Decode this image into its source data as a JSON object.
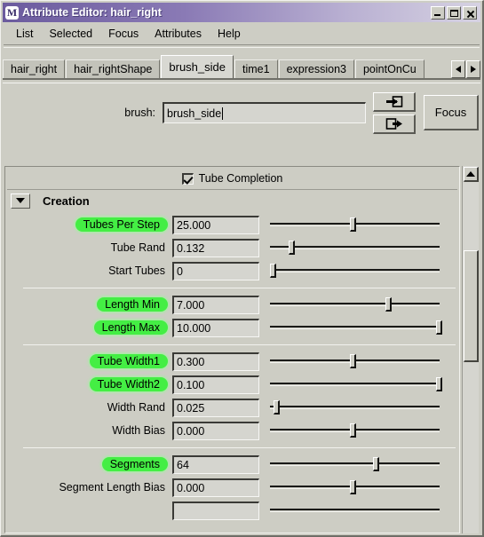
{
  "window": {
    "logo": "maya-m-logo",
    "title": "Attribute Editor: hair_right",
    "buttons": {
      "minimize": "minimize-icon",
      "maximize": "maximize-icon",
      "close": "close-icon"
    }
  },
  "menubar": {
    "items": [
      {
        "label": "List"
      },
      {
        "label": "Selected"
      },
      {
        "label": "Focus"
      },
      {
        "label": "Attributes"
      },
      {
        "label": "Help"
      }
    ]
  },
  "tabs": {
    "items": [
      {
        "label": "hair_right",
        "active": false
      },
      {
        "label": "hair_rightShape",
        "active": false
      },
      {
        "label": "brush_side",
        "active": true
      },
      {
        "label": "time1",
        "active": false
      },
      {
        "label": "expression3",
        "active": false
      },
      {
        "label": "pointOnCu",
        "active": false
      }
    ],
    "scroll_left": "triangle-left-icon",
    "scroll_right": "triangle-right-icon"
  },
  "node_header": {
    "field_label": "brush:",
    "field_value": "brush_side",
    "field_placeholder": "",
    "input_button_icon": "arrow-into-box-icon",
    "output_button_icon": "arrow-out-of-box-icon",
    "focus_label": "Focus"
  },
  "completion": {
    "label": "Tube Completion",
    "checked": true
  },
  "section": {
    "title": "Creation",
    "expanded": true,
    "collapse_icon": "triangle-down-icon"
  },
  "colors": {
    "keyed_highlight": "#44ee44",
    "window_bg": "#cdcdc4",
    "field_bg": "#d5d5cf",
    "titlebar_start": "#6b5b9e"
  },
  "groups": [
    {
      "rows": [
        {
          "label": "Tubes Per Step",
          "value": "25.000",
          "keyed": true,
          "slider_pct": 49
        },
        {
          "label": "Tube Rand",
          "value": "0.132",
          "keyed": false,
          "slider_pct": 13
        },
        {
          "label": "Start Tubes",
          "value": "0",
          "keyed": false,
          "slider_pct": 2
        }
      ]
    },
    {
      "rows": [
        {
          "label": "Length Min",
          "value": "7.000",
          "keyed": true,
          "slider_pct": 70
        },
        {
          "label": "Length Max",
          "value": "10.000",
          "keyed": true,
          "slider_pct": 100
        }
      ]
    },
    {
      "rows": [
        {
          "label": "Tube Width1",
          "value": "0.300",
          "keyed": true,
          "slider_pct": 49
        },
        {
          "label": "Tube Width2",
          "value": "0.100",
          "keyed": true,
          "slider_pct": 100
        },
        {
          "label": "Width Rand",
          "value": "0.025",
          "keyed": false,
          "slider_pct": 4
        },
        {
          "label": "Width Bias",
          "value": "0.000",
          "keyed": false,
          "slider_pct": 49
        }
      ]
    },
    {
      "rows": [
        {
          "label": "Segments",
          "value": "64",
          "keyed": true,
          "slider_pct": 63
        },
        {
          "label": "Segment Length Bias",
          "value": "0.000",
          "keyed": false,
          "slider_pct": 49
        }
      ]
    }
  ],
  "scrollbar": {
    "up_arrow": "triangle-up-icon",
    "thumb_top_pct": 19,
    "thumb_height_pct": 32
  }
}
